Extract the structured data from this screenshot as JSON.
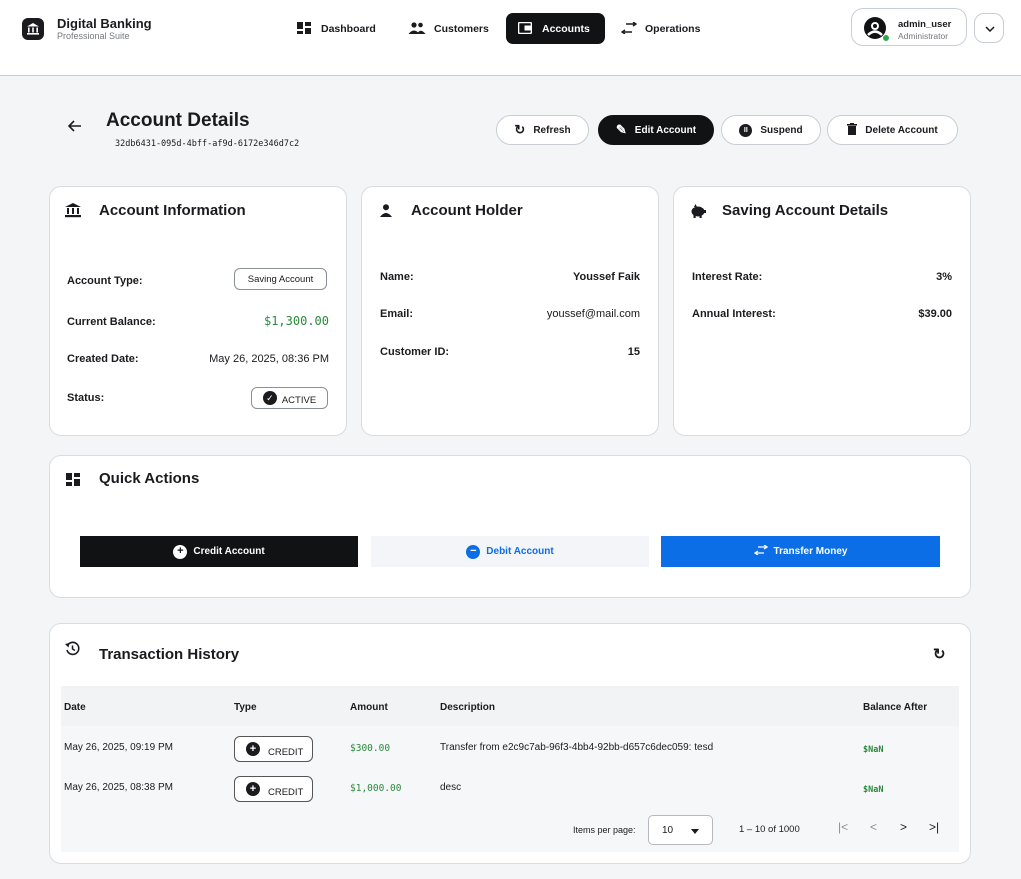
{
  "app": {
    "title": "Digital Banking",
    "subtitle": "Professional Suite"
  },
  "nav": [
    {
      "label": "Dashboard",
      "icon": "dashboard-icon"
    },
    {
      "label": "Customers",
      "icon": "people-icon"
    },
    {
      "label": "Accounts",
      "icon": "wallet-icon",
      "active": true
    },
    {
      "label": "Operations",
      "icon": "swap-icon"
    }
  ],
  "user": {
    "name": "admin_user",
    "role": "Administrator"
  },
  "header": {
    "title": "Account Details",
    "account_id": "32db6431-095d-4bff-af9d-6172e346d7c2",
    "actions": {
      "refresh": "Refresh",
      "edit": "Edit Account",
      "suspend": "Suspend",
      "delete": "Delete Account"
    }
  },
  "account_info": {
    "title": "Account Information",
    "type_label": "Account Type:",
    "type_value": "Saving Account",
    "balance_label": "Current Balance:",
    "balance_value": "$1,300.00",
    "created_label": "Created Date:",
    "created_value": "May 26, 2025, 08:36 PM",
    "status_label": "Status:",
    "status_value": "ACTIVE"
  },
  "holder": {
    "title": "Account Holder",
    "name_label": "Name:",
    "name_value": "Youssef Faik",
    "email_label": "Email:",
    "email_value": "youssef@mail.com",
    "id_label": "Customer ID:",
    "id_value": "15"
  },
  "saving": {
    "title": "Saving Account Details",
    "rate_label": "Interest Rate:",
    "rate_value": "3%",
    "annual_label": "Annual Interest:",
    "annual_value": "$39.00"
  },
  "quick_actions": {
    "title": "Quick Actions",
    "credit": "Credit Account",
    "debit": "Debit Account",
    "transfer": "Transfer Money"
  },
  "history": {
    "title": "Transaction History",
    "columns": [
      "Date",
      "Type",
      "Amount",
      "Description",
      "Balance After"
    ],
    "rows": [
      {
        "date": "May 26, 2025, 09:19 PM",
        "type": "CREDIT",
        "amount": "$300.00",
        "description": "Transfer from e2c9c7ab-96f3-4bb4-92bb-d657c6dec059: tesd",
        "balance_after": "$NaN"
      },
      {
        "date": "May 26, 2025, 08:38 PM",
        "type": "CREDIT",
        "amount": "$1,000.00",
        "description": "desc",
        "balance_after": "$NaN"
      }
    ],
    "pager": {
      "items_label": "Items per page:",
      "page_size": "10",
      "range": "1 – 10 of 1000"
    }
  },
  "colors": {
    "primary_dark": "#111214",
    "accent_blue": "#0b6ee6",
    "success_green": "#2a8a3c"
  }
}
